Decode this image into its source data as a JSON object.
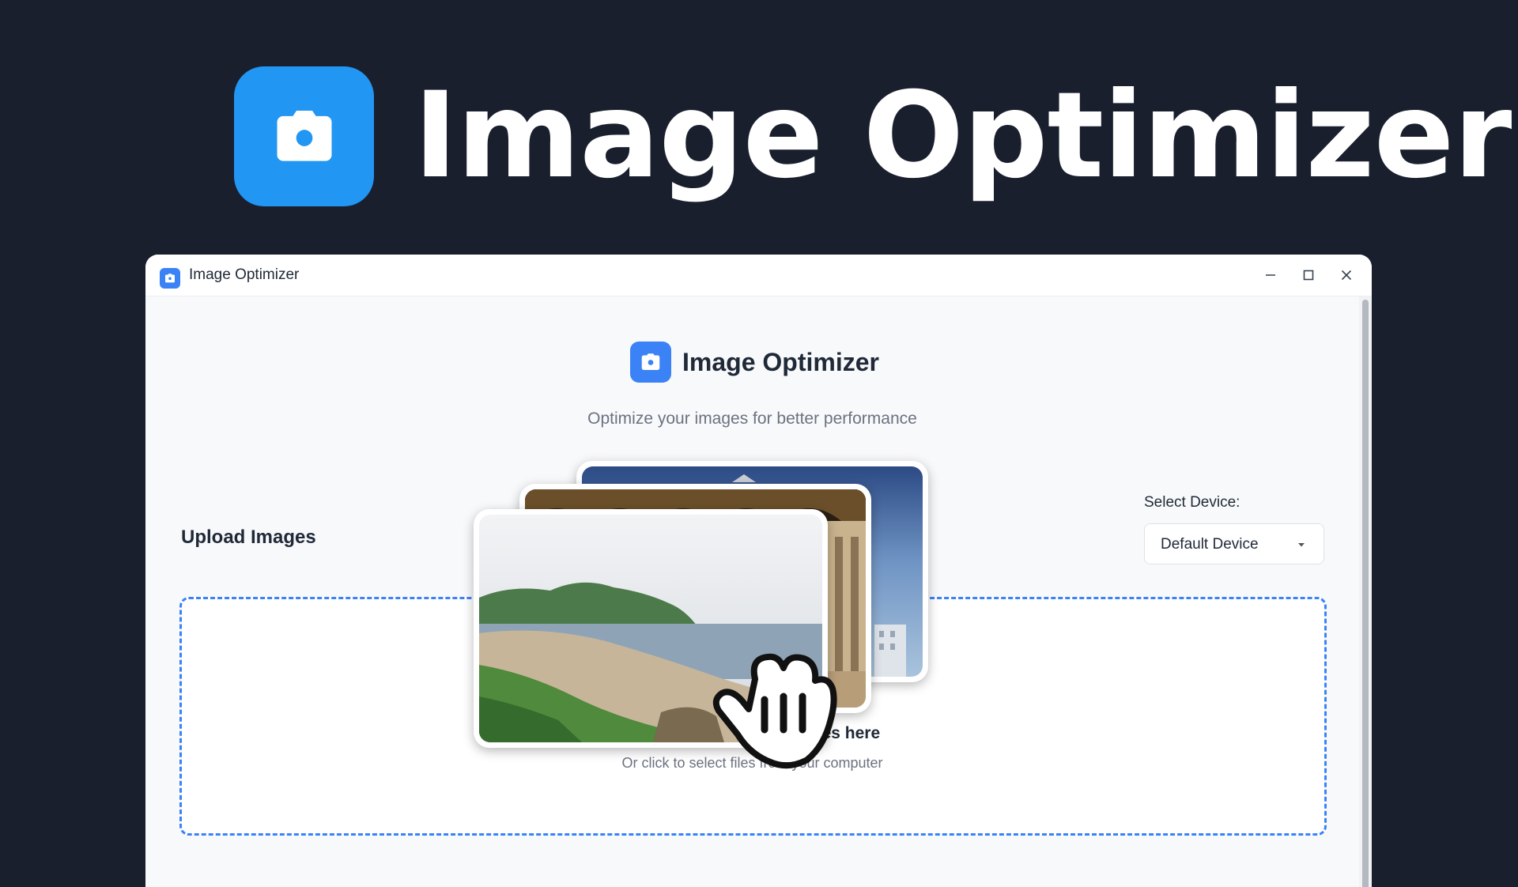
{
  "hero": {
    "title": "Image Optimizer",
    "logo_icon": "camera-icon",
    "accent_color": "#2196f3",
    "background_color": "#1a1f2e"
  },
  "window": {
    "title": "Image Optimizer",
    "app_icon": "camera-icon",
    "controls": [
      "minimize-icon",
      "maximize-icon",
      "close-icon"
    ]
  },
  "app": {
    "header_title": "Image Optimizer",
    "subtitle": "Optimize your images for better performance",
    "accent_color": "#3b82f6"
  },
  "upload": {
    "section_title": "Upload Images",
    "dropzone_text": "Drag and drop your images here",
    "dropzone_subtext": "Or click to select files from your computer"
  },
  "device": {
    "label": "Select Device:",
    "selected": "Default Device",
    "caret_icon": "caret-down-icon"
  },
  "illustration": {
    "photos": [
      "beach-landscape-photo",
      "arched-colonnade-photo",
      "building-sky-photo"
    ],
    "cursor_icon": "hand-grab-cursor-icon"
  }
}
